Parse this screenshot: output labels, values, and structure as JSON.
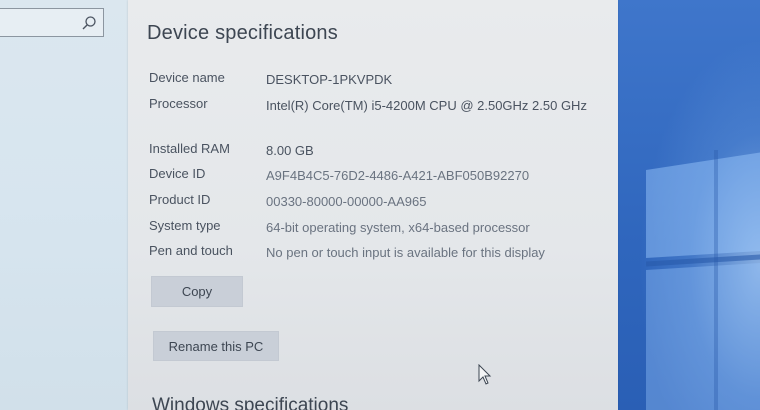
{
  "sidebar": {
    "search_icon": "search-icon"
  },
  "device_specifications": {
    "title": "Device specifications",
    "rows": [
      {
        "label": "Device name",
        "value": "DESKTOP-1PKVPDK"
      },
      {
        "label": "Processor",
        "value": "Intel(R) Core(TM) i5-4200M CPU @ 2.50GHz   2.50 GHz"
      },
      {
        "label": "Installed RAM",
        "value": "8.00 GB"
      },
      {
        "label": "Device ID",
        "value": "A9F4B4C5-76D2-4486-A421-ABF050B92270"
      },
      {
        "label": "Product ID",
        "value": "00330-80000-00000-AA965"
      },
      {
        "label": "System type",
        "value": "64-bit operating system, x64-based processor"
      },
      {
        "label": "Pen and touch",
        "value": "No pen or touch input is available for this display"
      }
    ],
    "copy_label": "Copy",
    "rename_label": "Rename this PC"
  },
  "windows_specifications": {
    "title": "Windows specifications"
  },
  "colors": {
    "panel_bg": "#e6e8eb",
    "button_bg": "#c9cfd8",
    "desktop_blue": "#3a6fc6"
  }
}
